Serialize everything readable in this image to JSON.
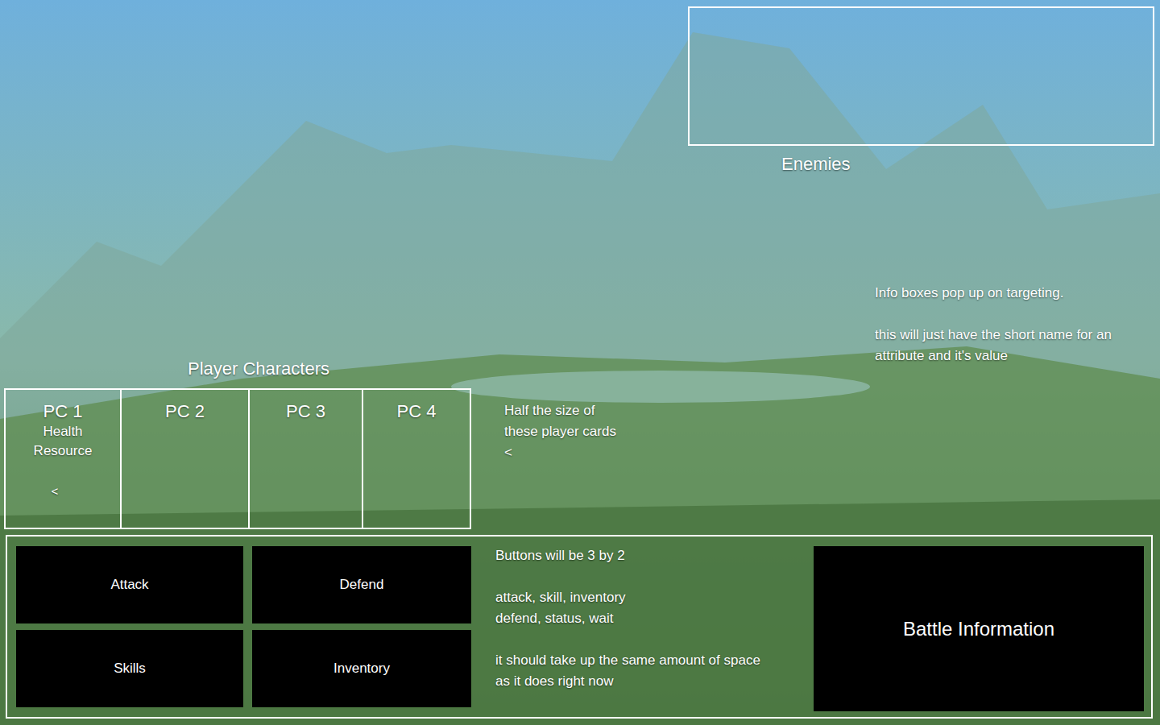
{
  "enemies": {
    "label": "Enemies"
  },
  "enemy_note": {
    "paragraphs": [
      [
        "Info boxes pop up on targeting."
      ],
      [
        "this will just have the short name for an attribute and it's value"
      ]
    ]
  },
  "party": {
    "label": "Player Characters",
    "cards": [
      {
        "name": "PC 1",
        "stats": [
          "Health",
          "Resource"
        ],
        "marker": "<"
      },
      {
        "name": "PC 2",
        "stats": [],
        "marker": ""
      },
      {
        "name": "PC 3",
        "stats": [],
        "marker": ""
      },
      {
        "name": "PC 4",
        "stats": [],
        "marker": ""
      }
    ]
  },
  "party_note": {
    "lines": [
      "Half the size of these player cards",
      "<"
    ]
  },
  "actions": [
    "Attack",
    "Defend",
    "Skills",
    "Inventory"
  ],
  "actions_note": {
    "paragraphs": [
      [
        "Buttons will be 3 by 2"
      ],
      [
        "attack, skill, inventory",
        "defend, status, wait"
      ],
      [
        "it should take up the same amount of space as it does right now"
      ]
    ]
  },
  "battle_info": {
    "title": "Battle Information"
  }
}
